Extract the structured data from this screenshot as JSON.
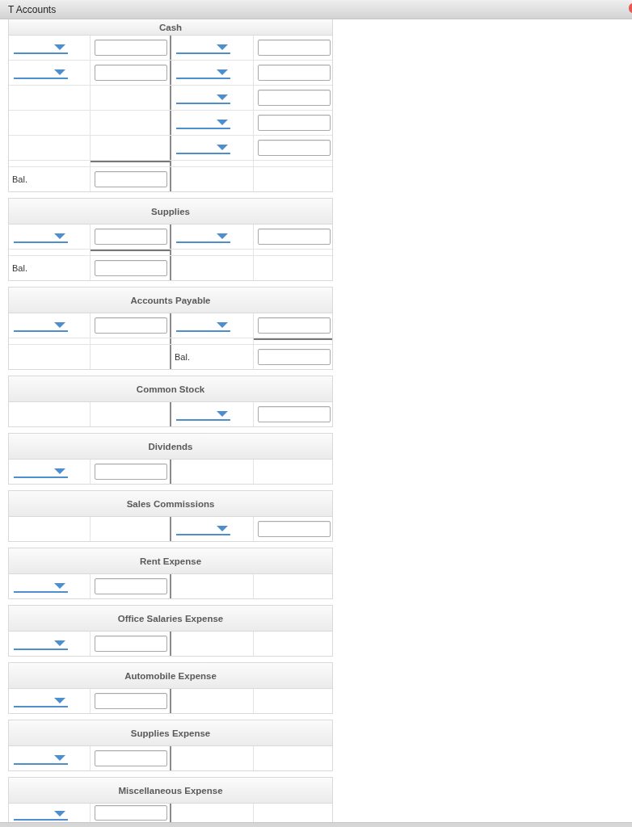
{
  "window": {
    "title": "T Accounts"
  },
  "accounts": [
    {
      "title": "Cash",
      "debit_total_rule": true,
      "credit_total_rule": false,
      "entries": [
        {
          "cells": [
            {
              "kind": "dropdown"
            },
            {
              "kind": "input"
            },
            {
              "kind": "dropdown"
            },
            {
              "kind": "input"
            }
          ]
        },
        {
          "cells": [
            {
              "kind": "dropdown"
            },
            {
              "kind": "input"
            },
            {
              "kind": "dropdown"
            },
            {
              "kind": "input"
            }
          ]
        },
        {
          "cells": [
            {
              "kind": "blank"
            },
            {
              "kind": "blank"
            },
            {
              "kind": "dropdown"
            },
            {
              "kind": "input"
            }
          ]
        },
        {
          "cells": [
            {
              "kind": "blank"
            },
            {
              "kind": "blank"
            },
            {
              "kind": "dropdown"
            },
            {
              "kind": "input"
            }
          ]
        },
        {
          "cells": [
            {
              "kind": "blank"
            },
            {
              "kind": "blank"
            },
            {
              "kind": "dropdown"
            },
            {
              "kind": "input"
            }
          ]
        }
      ],
      "balance": {
        "cells": [
          {
            "kind": "label",
            "text": "Bal."
          },
          {
            "kind": "input"
          },
          {
            "kind": "blank"
          },
          {
            "kind": "blank"
          }
        ]
      }
    },
    {
      "title": "Supplies",
      "debit_total_rule": true,
      "credit_total_rule": false,
      "entries": [
        {
          "cells": [
            {
              "kind": "dropdown"
            },
            {
              "kind": "input"
            },
            {
              "kind": "dropdown"
            },
            {
              "kind": "input"
            }
          ]
        }
      ],
      "balance": {
        "cells": [
          {
            "kind": "label",
            "text": "Bal."
          },
          {
            "kind": "input"
          },
          {
            "kind": "blank"
          },
          {
            "kind": "blank"
          }
        ]
      }
    },
    {
      "title": "Accounts Payable",
      "debit_total_rule": false,
      "credit_total_rule": true,
      "entries": [
        {
          "cells": [
            {
              "kind": "dropdown"
            },
            {
              "kind": "input"
            },
            {
              "kind": "dropdown"
            },
            {
              "kind": "input"
            }
          ]
        }
      ],
      "balance": {
        "cells": [
          {
            "kind": "blank"
          },
          {
            "kind": "blank"
          },
          {
            "kind": "label",
            "text": "Bal."
          },
          {
            "kind": "input"
          }
        ]
      }
    },
    {
      "title": "Common Stock",
      "entries": [
        {
          "cells": [
            {
              "kind": "blank"
            },
            {
              "kind": "blank"
            },
            {
              "kind": "dropdown"
            },
            {
              "kind": "input"
            }
          ]
        }
      ]
    },
    {
      "title": "Dividends",
      "entries": [
        {
          "cells": [
            {
              "kind": "dropdown"
            },
            {
              "kind": "input"
            },
            {
              "kind": "blank"
            },
            {
              "kind": "blank"
            }
          ]
        }
      ]
    },
    {
      "title": "Sales Commissions",
      "entries": [
        {
          "cells": [
            {
              "kind": "blank"
            },
            {
              "kind": "blank"
            },
            {
              "kind": "dropdown"
            },
            {
              "kind": "input"
            }
          ]
        }
      ]
    },
    {
      "title": "Rent Expense",
      "entries": [
        {
          "cells": [
            {
              "kind": "dropdown"
            },
            {
              "kind": "input"
            },
            {
              "kind": "blank"
            },
            {
              "kind": "blank"
            }
          ]
        }
      ]
    },
    {
      "title": "Office Salaries Expense",
      "entries": [
        {
          "cells": [
            {
              "kind": "dropdown"
            },
            {
              "kind": "input"
            },
            {
              "kind": "blank"
            },
            {
              "kind": "blank"
            }
          ]
        }
      ]
    },
    {
      "title": "Automobile Expense",
      "entries": [
        {
          "cells": [
            {
              "kind": "dropdown"
            },
            {
              "kind": "input"
            },
            {
              "kind": "blank"
            },
            {
              "kind": "blank"
            }
          ]
        }
      ]
    },
    {
      "title": "Supplies Expense",
      "entries": [
        {
          "cells": [
            {
              "kind": "dropdown"
            },
            {
              "kind": "input"
            },
            {
              "kind": "blank"
            },
            {
              "kind": "blank"
            }
          ]
        }
      ]
    },
    {
      "title": "Miscellaneous Expense",
      "entries": [
        {
          "cells": [
            {
              "kind": "dropdown"
            },
            {
              "kind": "input"
            },
            {
              "kind": "blank"
            },
            {
              "kind": "blank"
            }
          ]
        }
      ]
    }
  ]
}
